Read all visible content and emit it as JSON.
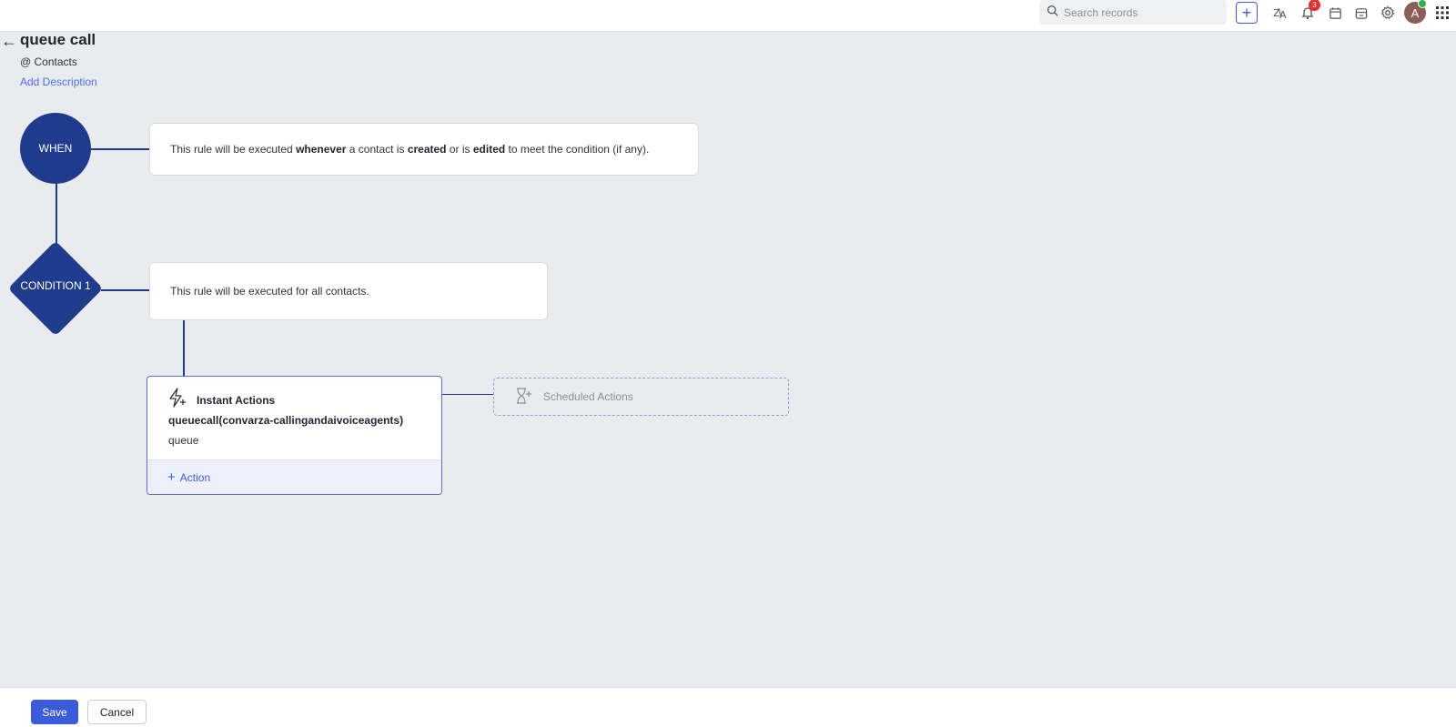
{
  "topbar": {
    "search_placeholder": "Search records",
    "notifications_count": "3",
    "avatar_initial": "A",
    "icons": [
      "search-icon",
      "add-icon",
      "translate-icon",
      "bell-icon",
      "calendar-icon",
      "marketplace-icon",
      "gear-icon",
      "avatar",
      "apps-grid-icon"
    ]
  },
  "header": {
    "title": "queue call",
    "module": "@ Contacts",
    "add_description": "Add Description"
  },
  "workflow": {
    "when_label": "WHEN",
    "when_text": {
      "p1": "This rule will be executed ",
      "b1": "whenever",
      "p2": " a contact is ",
      "b2": "created",
      "p3": " or is ",
      "b3": "edited",
      "p4": " to meet the condition (if any)."
    },
    "condition_label": "CONDITION 1",
    "condition_text": "This rule will be executed for all contacts.",
    "instant_actions": {
      "title": "Instant Actions",
      "function_name": "queuecall(convarza-callingandaivoiceagents)",
      "function_sub": "queue",
      "add_action_label": "Action"
    },
    "scheduled_actions_label": "Scheduled Actions"
  },
  "footer": {
    "save_label": "Save",
    "cancel_label": "Cancel"
  },
  "colors": {
    "node": "#1f3b8c",
    "accent": "#3b5bdb",
    "background": "#e9ebee"
  }
}
